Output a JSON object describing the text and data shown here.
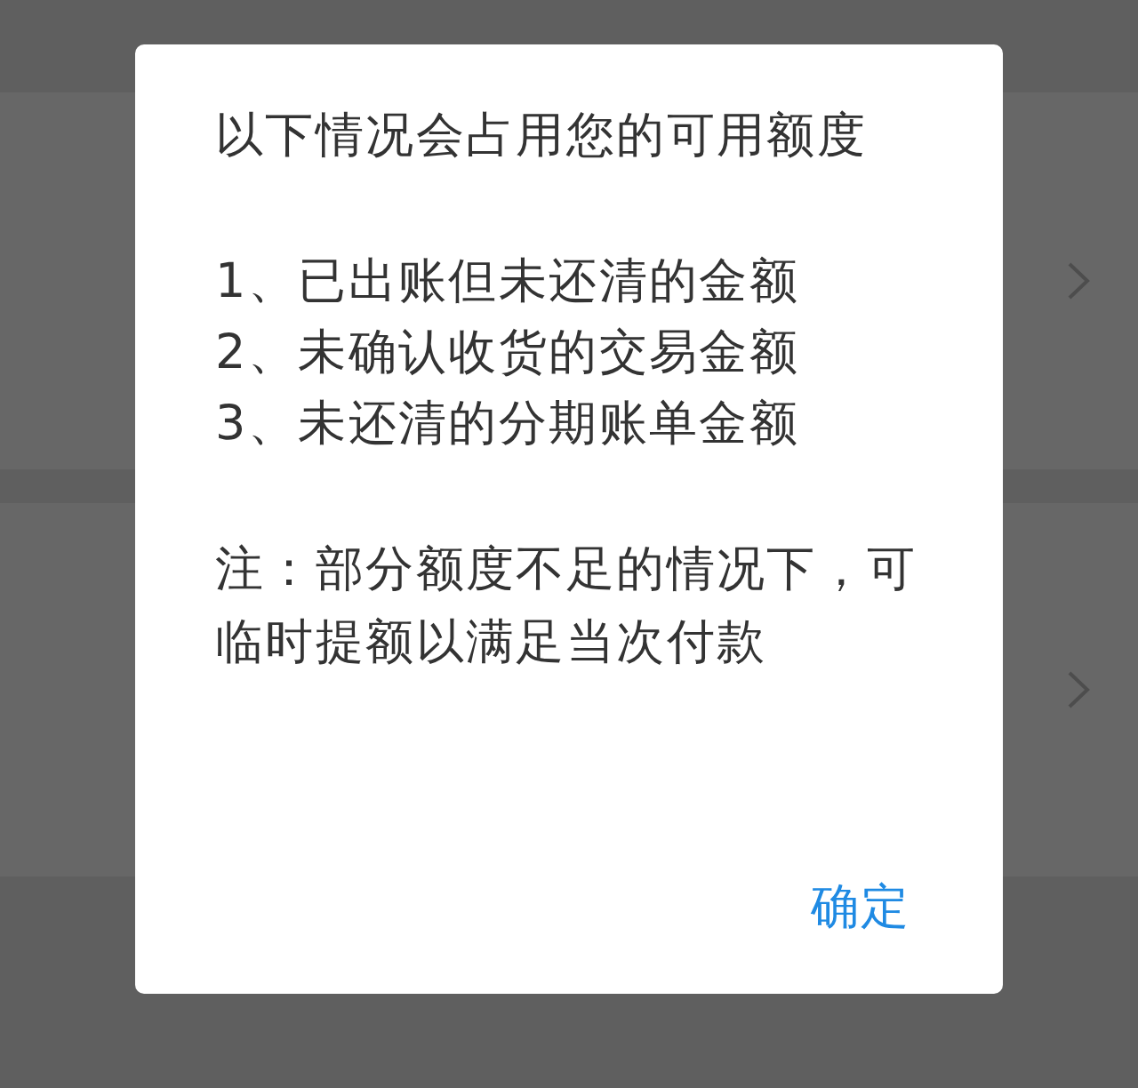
{
  "page": {
    "rows": [
      {
        "chevron": true
      },
      {
        "chevron": true
      }
    ]
  },
  "dialog": {
    "title": "以下情况会占用您的可用额度",
    "items": [
      "1、已出账但未还清的金额",
      "2、未确认收货的交易金额",
      "3、未还清的分期账单金额"
    ],
    "note": "注：部分额度不足的情况下，可临时提额以满足当次付款",
    "button": "确定"
  }
}
